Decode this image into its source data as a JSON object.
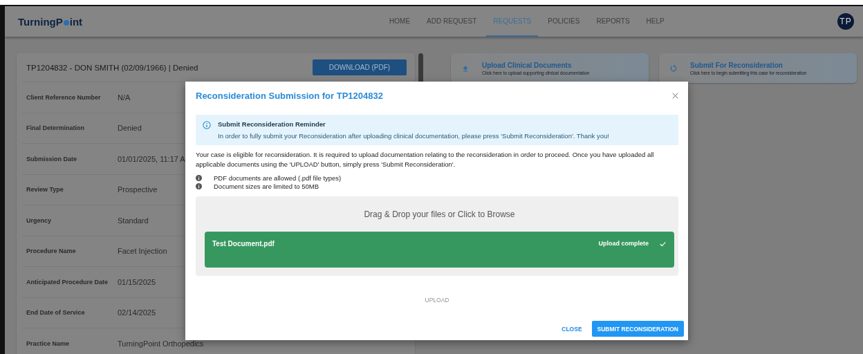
{
  "header": {
    "logo": {
      "before": "TurningP",
      "after": "int"
    },
    "nav": [
      {
        "label": "HOME",
        "selected": false
      },
      {
        "label": "ADD REQUEST",
        "selected": false
      },
      {
        "label": "REQUESTS",
        "selected": true
      },
      {
        "label": "POLICIES",
        "selected": false
      },
      {
        "label": "REPORTS",
        "selected": false
      },
      {
        "label": "HELP",
        "selected": false
      }
    ],
    "avatar": "TP"
  },
  "case": {
    "title": "TP1204832 - DON SMITH (02/09/1966) | Denied",
    "download_button": "DOWNLOAD (PDF)",
    "details": [
      {
        "label": "Client Reference Number",
        "value": "N/A"
      },
      {
        "label": "Final Determination",
        "value": "Denied"
      },
      {
        "label": "Submission Date",
        "value": "01/01/2025, 11:17 A"
      },
      {
        "label": "Review Type",
        "value": "Prospective"
      },
      {
        "label": "Urgency",
        "value": "Standard"
      },
      {
        "label": "Procedure Name",
        "value": "Facet Injection"
      },
      {
        "label": "Anticipated Procedure Date",
        "value": "01/15/2025"
      },
      {
        "label": "End Date of Service",
        "value": "02/14/2025"
      },
      {
        "label": "Practice Name",
        "value": "TurningPoint Orthopedics"
      }
    ]
  },
  "actions": [
    {
      "kind": "upload",
      "title": "Upload Clinical Documents",
      "subtitle": "Click here to upload supporting clinical documentation"
    },
    {
      "kind": "reconsider",
      "title": "Submit For Reconsideration",
      "subtitle": "Click here to begin submitting this case for reconsideration"
    }
  ],
  "modal": {
    "title": "Reconsideration Submission for TP1204832",
    "alert": {
      "title": "Submit Reconsideration Reminder",
      "text": "In order to fully submit your Reconsideration after uploading clinical documentation, please press 'Submit Reconsideration'. Thank you!"
    },
    "intro": "Your case is eligible for reconsideration. It is required to upload documentation relating to the reconsideration in order to proceed. Once you have uploaded all applicable documents using the 'UPLOAD' button, simply press 'Submit Reconsideration'.",
    "notes": [
      "PDF documents are allowed (.pdf file types)",
      "Document sizes are limited to 50MB"
    ],
    "dropzone": {
      "prompt": "Drag & Drop your files or Click to Browse",
      "files": [
        {
          "name": "Test Document.pdf",
          "status": "Upload complete",
          "complete": true
        }
      ]
    },
    "upload_button": {
      "label": "UPLOAD",
      "disabled": true
    },
    "close_button": "CLOSE",
    "submit_button": "SUBMIT RECONSIDERATION"
  }
}
